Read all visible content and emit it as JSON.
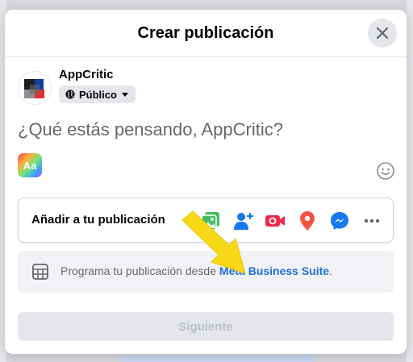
{
  "dialog": {
    "title": "Crear publicación"
  },
  "user": {
    "name": "AppCritic",
    "privacy": "Público"
  },
  "composer": {
    "placeholder": "¿Qué estás pensando, AppCritic?",
    "text_format_label": "Aa"
  },
  "add_to_post": {
    "label": "Añadir a tu publicación",
    "options": [
      "photo-video-icon",
      "tag-people-icon",
      "live-video-icon",
      "check-in-icon",
      "messenger-icon",
      "more-icon"
    ]
  },
  "schedule": {
    "text": "Programa tu publicación desde ",
    "link": "Meta Business Suite",
    "suffix": "."
  },
  "footer": {
    "next_label": "Siguiente"
  },
  "colors": {
    "accent": "#216fdb",
    "arrow": "#f7d917"
  }
}
